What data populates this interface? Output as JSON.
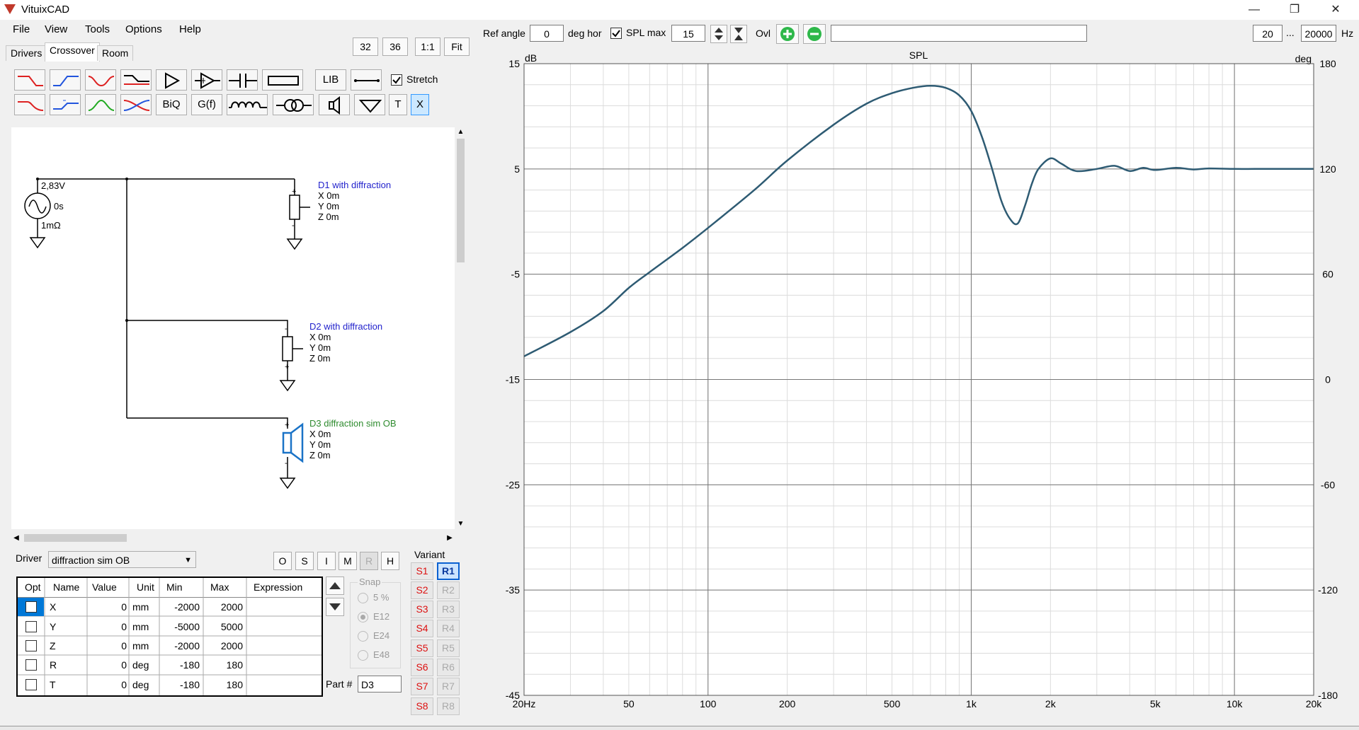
{
  "app": {
    "title": "VituixCAD"
  },
  "menu": [
    "File",
    "View",
    "Tools",
    "Options",
    "Help"
  ],
  "tabs": [
    "Drivers",
    "Crossover",
    "Room"
  ],
  "zoom_buttons": [
    "32",
    "36",
    "1:1",
    "Fit"
  ],
  "toolbar": {
    "lib": "LIB",
    "biq": "BiQ",
    "gf": "G(f)",
    "t": "T",
    "x": "X",
    "stretch": "Stretch",
    "stretch_checked": true
  },
  "schematic": {
    "source": {
      "voltage": "2,83V",
      "delay": "0s",
      "impedance": "1mΩ"
    },
    "d1": {
      "name": "D1 with diffraction",
      "x": "X 0m",
      "y": "Y 0m",
      "z": "Z 0m",
      "color": "#2222cc"
    },
    "d2": {
      "name": "D2 with diffraction",
      "x": "X 0m",
      "y": "Y 0m",
      "z": "Z 0m",
      "color": "#2222cc"
    },
    "d3": {
      "name": "D3 diffraction sim OB",
      "x": "X 0m",
      "y": "Y 0m",
      "z": "Z 0m",
      "color": "#2e8b2e"
    }
  },
  "driver": {
    "label": "Driver",
    "selected": "diffraction sim OB"
  },
  "omirh": [
    "O",
    "S",
    "I",
    "M",
    "R",
    "H"
  ],
  "table": {
    "headers": [
      "Opt",
      "Name",
      "Value",
      "Unit",
      "Min",
      "Max",
      "Expression"
    ],
    "rows": [
      {
        "name": "X",
        "value": "0",
        "unit": "mm",
        "min": "-2000",
        "max": "2000"
      },
      {
        "name": "Y",
        "value": "0",
        "unit": "mm",
        "min": "-5000",
        "max": "5000"
      },
      {
        "name": "Z",
        "value": "0",
        "unit": "mm",
        "min": "-2000",
        "max": "2000"
      },
      {
        "name": "R",
        "value": "0",
        "unit": "deg",
        "min": "-180",
        "max": "180"
      },
      {
        "name": "T",
        "value": "0",
        "unit": "deg",
        "min": "-180",
        "max": "180"
      }
    ]
  },
  "snap": {
    "label": "Snap",
    "options": [
      "5 %",
      "E12",
      "E24",
      "E48"
    ],
    "selected": "E12"
  },
  "part": {
    "label": "Part #",
    "value": "D3"
  },
  "variant": {
    "label": "Variant",
    "s": [
      "S1",
      "S2",
      "S3",
      "S4",
      "S5",
      "S6",
      "S7",
      "S8"
    ],
    "r": [
      "R1",
      "R2",
      "R3",
      "R4",
      "R5",
      "R6",
      "R7",
      "R8"
    ],
    "selected": "R1"
  },
  "top_controls": {
    "ref_angle_label": "Ref angle",
    "ref_angle": "0",
    "deg_hor": "deg hor",
    "spl_max_label": "SPL max",
    "spl_max": "15",
    "spl_max_checked": true,
    "ovl": "Ovl",
    "f_min": "20",
    "ellipsis": "...",
    "f_max": "20000",
    "hz": "Hz"
  },
  "chart_data": {
    "type": "line",
    "title": "SPL",
    "ylabel": "dB",
    "y2label": "deg",
    "xscale": "log",
    "xlim": [
      20,
      20000
    ],
    "ylim": [
      -45,
      15
    ],
    "y2lim": [
      -180,
      180
    ],
    "grid": true,
    "x_tick_labels": [
      "20Hz",
      "50",
      "100",
      "200",
      "500",
      "1k",
      "2k",
      "5k",
      "10k",
      "20k"
    ],
    "x_tick_values": [
      20,
      50,
      100,
      200,
      500,
      1000,
      2000,
      5000,
      10000,
      20000
    ],
    "y_tick_labels": [
      "15",
      "5",
      "-5",
      "-15",
      "-25",
      "-35",
      "-45"
    ],
    "y2_tick_labels": [
      "180",
      "120",
      "60",
      "0",
      "-60",
      "-120",
      "-180"
    ],
    "series": [
      {
        "color": "#2e5b73",
        "x": [
          20,
          30,
          40,
          50,
          60,
          80,
          100,
          150,
          200,
          300,
          400,
          500,
          600,
          700,
          800,
          900,
          1000,
          1100,
          1200,
          1300,
          1400,
          1500,
          1600,
          1700,
          1800,
          2000,
          2200,
          2500,
          3000,
          3500,
          4000,
          4500,
          5000,
          6000,
          7000,
          8000,
          10000,
          12000,
          15000,
          20000
        ],
        "y": [
          -12.8,
          -10.5,
          -8.5,
          -6.3,
          -4.8,
          -2.5,
          -0.6,
          3.0,
          5.8,
          9.2,
          11.2,
          12.2,
          12.7,
          12.9,
          12.7,
          12.0,
          10.5,
          8.0,
          5.0,
          2.0,
          0.3,
          -0.2,
          1.5,
          3.6,
          5.0,
          6.0,
          5.5,
          4.8,
          5.0,
          5.3,
          4.8,
          5.1,
          4.9,
          5.1,
          4.95,
          5.05,
          5.0,
          5.0,
          5.0,
          5.0
        ]
      }
    ]
  }
}
